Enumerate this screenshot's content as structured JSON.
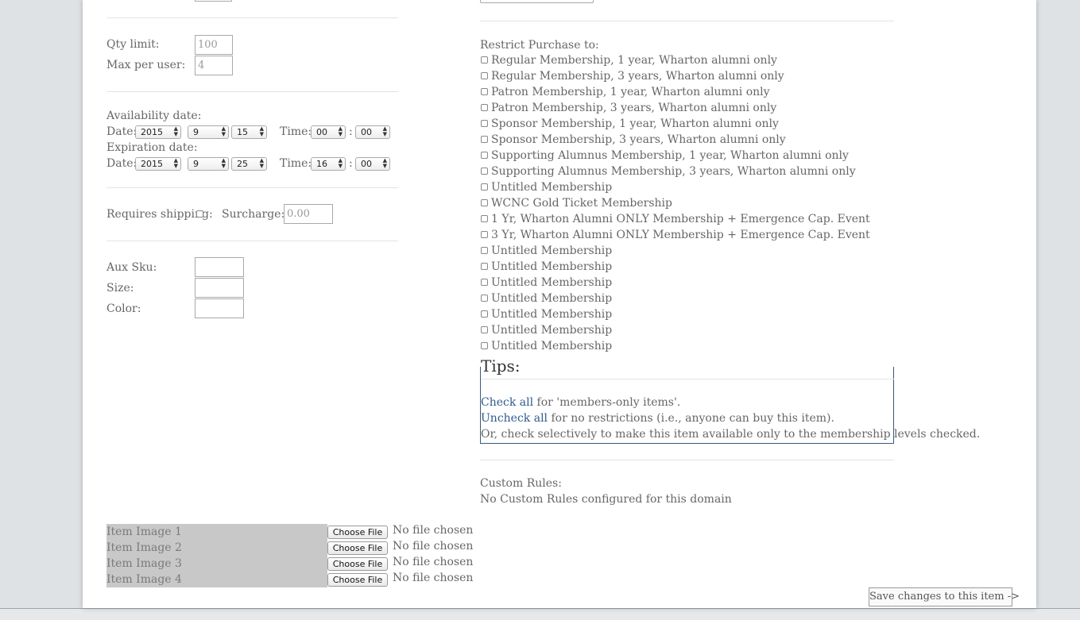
{
  "left": {
    "qty_limit_label": "Qty limit:",
    "qty_limit_value": "100",
    "max_per_user_label": "Max per user:",
    "max_per_user_value": "4",
    "availability_label": "Availability date:",
    "expiration_label": "Expiration date:",
    "date_label": "Date:",
    "time_label": "Time:",
    "colon": ":",
    "availability": {
      "year": "2015",
      "month": "9",
      "day": "15",
      "hour": "00",
      "minute": "00"
    },
    "expiration": {
      "year": "2015",
      "month": "9",
      "day": "25",
      "hour": "16",
      "minute": "00"
    },
    "requires_shipping_label": "Requires shipping:",
    "surcharge_label": "Surcharge: $",
    "surcharge_value": "0.00",
    "aux_sku_label": "Aux Sku:",
    "size_label": "Size:",
    "color_label": "Color:",
    "images": [
      {
        "label": "Item Image 1",
        "button": "Choose File",
        "status": "No file chosen"
      },
      {
        "label": "Item Image 2",
        "button": "Choose File",
        "status": "No file chosen"
      },
      {
        "label": "Item Image 3",
        "button": "Choose File",
        "status": "No file chosen"
      },
      {
        "label": "Item Image 4",
        "button": "Choose File",
        "status": "No file chosen"
      }
    ]
  },
  "right": {
    "restrict_label": "Restrict Purchase to:",
    "memberships": [
      "Regular Membership, 1 year, Wharton alumni only",
      "Regular Membership, 3 years, Wharton alumni only",
      "Patron Membership, 1 year, Wharton alumni only",
      "Patron Membership, 3 years, Wharton alumni only",
      "Sponsor Membership, 1 year, Wharton alumni only",
      "Sponsor Membership, 3 years, Wharton alumni only",
      "Supporting Alumnus Membership, 1 year, Wharton alumni only",
      "Supporting Alumnus Membership, 3 years, Wharton alumni only",
      "Untitled Membership",
      "WCNC Gold Ticket Membership",
      "1 Yr, Wharton Alumni ONLY Membership + Emergence Cap. Event",
      "3 Yr, Wharton Alumni ONLY Membership + Emergence Cap. Event",
      "Untitled Membership",
      "Untitled Membership",
      "Untitled Membership",
      "Untitled Membership",
      "Untitled Membership",
      "Untitled Membership",
      "Untitled Membership"
    ],
    "tips": {
      "title": "Tips:",
      "check_all_link": "Check all",
      "check_all_text": " for 'members-only items'.",
      "uncheck_all_link": "Uncheck all",
      "uncheck_all_text": " for no restrictions (i.e., anyone can buy this item).",
      "selective_text": "Or, check selectively to make this item available only to the membership levels checked."
    },
    "custom_rules_label": "Custom Rules:",
    "custom_rules_value": "No Custom Rules configured for this domain"
  },
  "save_button": "Save changes to this item ->"
}
